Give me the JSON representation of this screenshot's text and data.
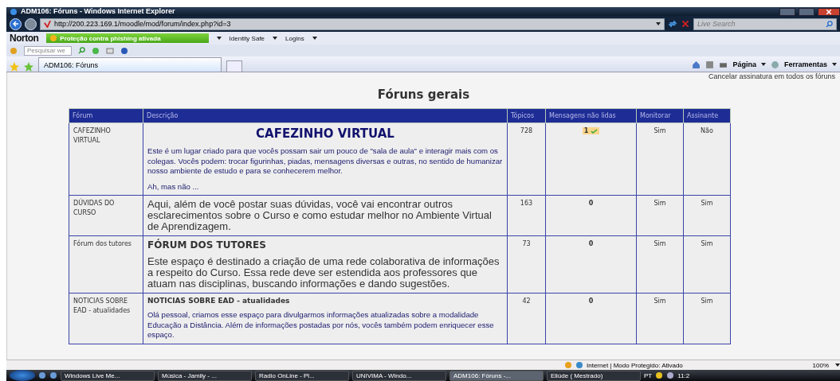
{
  "window": {
    "title": "ADM106: Fóruns - Windows Internet Explorer"
  },
  "address_bar": {
    "url": "http://200.223.169.1/moodle/mod/forum/index.php?id=3",
    "search_placeholder": "Live Search"
  },
  "norton_bar": {
    "brand": "Norton",
    "phishing_status": "Proteção contra phishing ativada",
    "identity_safe": "Identity Safe",
    "logins": "Logins"
  },
  "command_bar": {
    "search_placeholder": "Pesquisar we"
  },
  "tabs": [
    {
      "label": "ADM106: Fóruns",
      "selected": true
    }
  ],
  "tab_tools": {
    "page": "Página",
    "tools": "Ferramentas"
  },
  "page": {
    "unsubscribe_link": "Cancelar assinatura em todos os fóruns",
    "title": "Fóruns gerais",
    "table": {
      "columns": [
        "Fórum",
        "Descrição",
        "Tópicos",
        "Mensagens não lidas",
        "Monitorar",
        "Assinante"
      ],
      "rows": [
        {
          "forum": "CAFEZINHO VIRTUAL",
          "description": {
            "kind": "banner",
            "heading": "CAFEZINHO VIRTUAL",
            "paragraphs": [
              "Este é um lugar criado para que vocês possam sair um pouco de \"sala de aula\" e interagir mais com os colegas. Vocês podem: trocar figurinhas, piadas, mensagens diversas e outras, no sentido de humanizar nosso ambiente de estudo e para se conhecerem melhor.",
              "Ah, mas não ..."
            ]
          },
          "topics": "728",
          "unread": {
            "count": "1",
            "highlighted": true
          },
          "track": "Sim",
          "subscribed": "Não"
        },
        {
          "forum": "DÚVIDAS DO CURSO",
          "description": {
            "kind": "plain",
            "paragraphs": [
              "Aqui, além de você postar suas dúvidas, você vai encontrar outros esclarecimentos sobre o Curso e como estudar melhor no Ambiente Virtual de Aprendizagem."
            ]
          },
          "topics": "163",
          "unread": {
            "count": "0",
            "highlighted": false
          },
          "track": "Sim",
          "subscribed": "Sim"
        },
        {
          "forum": "Fórum dos tutores",
          "description": {
            "kind": "titled",
            "heading": "FÓRUM DOS TUTORES",
            "paragraphs": [
              "Este espaço é destinado a criação de uma rede colaborativa de informações a respeito do Curso. Essa rede deve ser estendida aos professores que atuam nas disciplinas, buscando informações e dando sugestões."
            ]
          },
          "topics": "73",
          "unread": {
            "count": "0",
            "highlighted": false
          },
          "track": "Sim",
          "subscribed": "Sim"
        },
        {
          "forum": "NOTICIAS SOBRE EAD - atualidades",
          "description": {
            "kind": "note",
            "heading": "NOTICIAS SOBRE EAD - atualidades",
            "paragraphs": [
              "Olá pessoal, criamos esse espaço para divulgarmos informações atualizadas sobre a modalidade Educação a Distância. Além de informações postadas por nós, vocês também podem enriquecer esse espaço."
            ]
          },
          "topics": "42",
          "unread": {
            "count": "0",
            "highlighted": false
          },
          "track": "Sim",
          "subscribed": "Sim"
        }
      ]
    }
  },
  "status_bar": {
    "zone": "Internet | Modo Protegido: Ativado",
    "zoom": "100%"
  },
  "taskbar": {
    "items": [
      {
        "label": "Windows Live Me...",
        "selected": false
      },
      {
        "label": "Música - Jamily - ...",
        "selected": false
      },
      {
        "label": "Radio OnLine - Pl...",
        "selected": false
      },
      {
        "label": "UNIVIMA - Windo...",
        "selected": false
      },
      {
        "label": "ADM106: Fóruns -...",
        "selected": true
      },
      {
        "label": "Eliúde ( Mestrado)",
        "selected": false
      }
    ],
    "language": "PT",
    "clock": "11:2"
  }
}
